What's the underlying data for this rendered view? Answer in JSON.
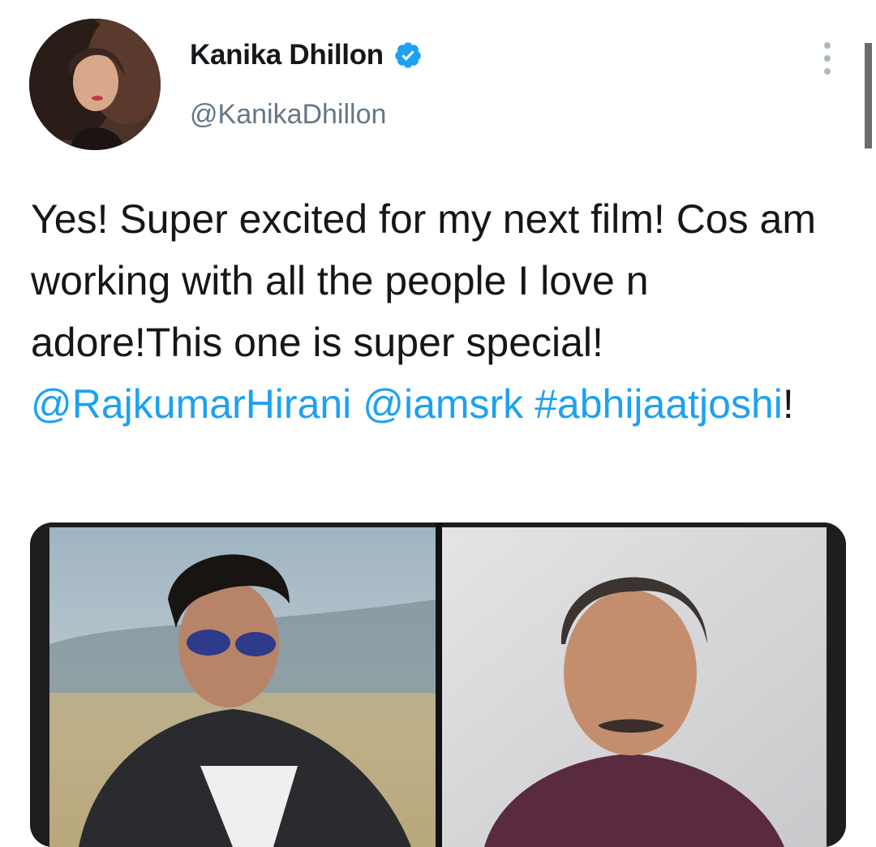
{
  "user": {
    "display_name": "Kanika Dhillon",
    "handle": "@KanikaDhillon",
    "verified": true
  },
  "tweet": {
    "text_parts": [
      {
        "text": "Yes! Super excited for my next film! Cos am working with all the people I love n adore!This one is super special! ",
        "link": false
      },
      {
        "text": "@RajkumarHirani",
        "link": true
      },
      {
        "text": " ",
        "link": false
      },
      {
        "text": "@iamsrk",
        "link": true
      },
      {
        "text": " ",
        "link": false
      },
      {
        "text": "#abhijaatjoshi",
        "link": true
      },
      {
        "text": "!",
        "link": false
      }
    ]
  },
  "icons": {
    "verified": "verified-badge-icon",
    "more": "more-options-icon"
  },
  "colors": {
    "link": "#1da1f2",
    "secondary_text": "#657786",
    "verified": "#1da1f2"
  }
}
